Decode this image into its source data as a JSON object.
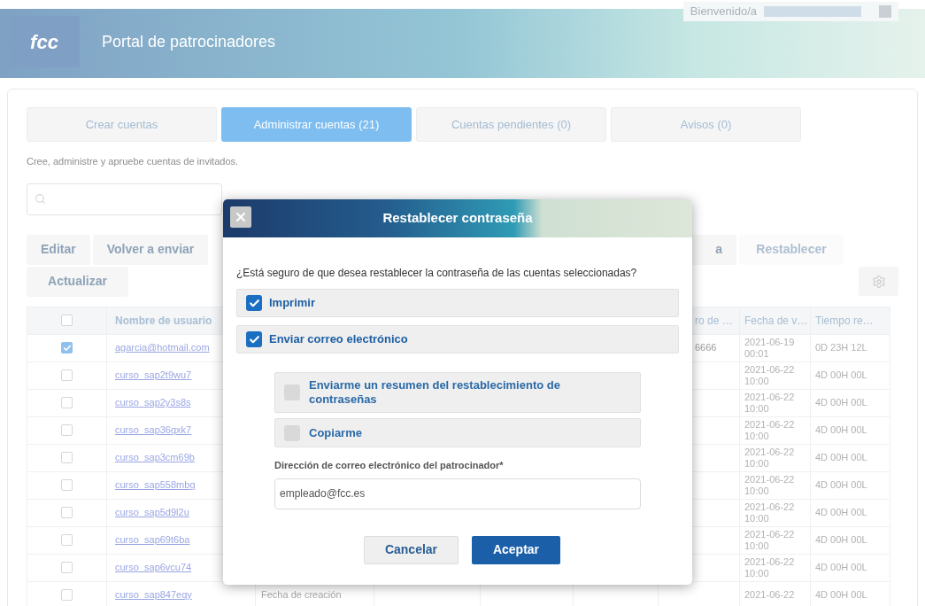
{
  "header": {
    "logo": "fcc",
    "title": "Portal de patrocinadores",
    "welcome": "Bienvenido/a"
  },
  "tabs": [
    {
      "label": "Crear cuentas",
      "selected": false
    },
    {
      "label": "Administrar cuentas (21)",
      "selected": true
    },
    {
      "label": "Cuentas pendientes (0)",
      "selected": false
    },
    {
      "label": "Avisos (0)",
      "selected": false
    }
  ],
  "description": "Cree, administre y apruebe cuentas de invitados.",
  "toolbar": [
    {
      "label": "Editar",
      "disabled": false
    },
    {
      "label": "Volver a enviar",
      "disabled": false
    },
    {
      "label": "a",
      "disabled": false
    },
    {
      "label": "Restablecer",
      "disabled": true
    },
    {
      "label": "Actualizar",
      "disabled": false
    }
  ],
  "table": {
    "header_checked": false,
    "columns": [
      {
        "label": "Nombre de usuario"
      },
      {
        "label": "ro de …"
      },
      {
        "label": "Fecha de v…"
      },
      {
        "label": "Tiempo re…"
      }
    ],
    "rows": [
      {
        "checked": true,
        "user": "agarcia@hotmail.com",
        "column_7": "6666",
        "expiry": "2021-06-19 00:01",
        "remaining": "0D 23H 12L"
      },
      {
        "checked": false,
        "user": "curso_sap2t9wu7",
        "expiry": "2021-06-22 10:00",
        "remaining": "4D 00H 00L"
      },
      {
        "checked": false,
        "user": "curso_sap2y3s8s",
        "expiry": "2021-06-22 10:00",
        "remaining": "4D 00H 00L"
      },
      {
        "checked": false,
        "user": "curso_sap36qxk7",
        "expiry": "2021-06-22 10:00",
        "remaining": "4D 00H 00L"
      },
      {
        "checked": false,
        "user": "curso_sap3cm69b",
        "expiry": "2021-06-22 10:00",
        "remaining": "4D 00H 00L"
      },
      {
        "checked": false,
        "user": "curso_sap558mbg",
        "expiry": "2021-06-22 10:00",
        "remaining": "4D 00H 00L"
      },
      {
        "checked": false,
        "user": "curso_sap5d9l2u",
        "expiry": "2021-06-22 10:00",
        "remaining": "4D 00H 00L"
      },
      {
        "checked": false,
        "user": "curso_sap69t6ba",
        "expiry": "2021-06-22 10:00",
        "remaining": "4D 00H 00L"
      },
      {
        "checked": false,
        "user": "curso_sap6vcu74",
        "expiry": "2021-06-22 10:00",
        "remaining": "4D 00H 00L"
      },
      {
        "checked": false,
        "user": "curso_sap847eqy",
        "column_3": "Fecha de creación",
        "expiry": "2021-06-22",
        "remaining": "4D 00H 00L"
      }
    ]
  },
  "modal": {
    "title": "Restablecer contraseña",
    "question": "¿Está seguro de que desea restablecer la contraseña de las cuentas seleccionadas?",
    "options": [
      {
        "label": "Imprimir",
        "checked": true
      },
      {
        "label": "Enviar correo electrónico",
        "checked": true
      }
    ],
    "sub_options": [
      {
        "label": "Enviarme un resumen del restablecimiento de contraseñas",
        "checked": false
      },
      {
        "label": "Copiarme",
        "checked": false
      }
    ],
    "email_label": "Dirección de correo electrónico del patrocinador*",
    "email_value": "empleado@fcc.es",
    "buttons": [
      {
        "label": "Cancelar",
        "kind": "secondary"
      },
      {
        "label": "Aceptar",
        "kind": "primary"
      }
    ]
  }
}
